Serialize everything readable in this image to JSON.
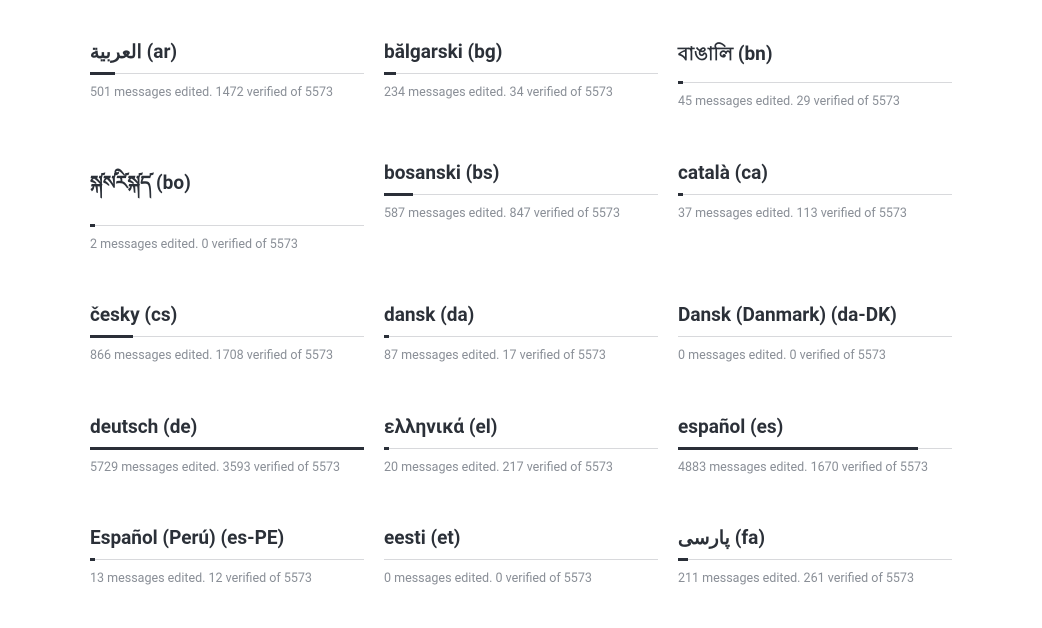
{
  "total_messages": 5573,
  "languages": [
    {
      "native": "العربية",
      "code": "ar",
      "edited": 501,
      "verified": 1472
    },
    {
      "native": "bălgarski",
      "code": "bg",
      "edited": 234,
      "verified": 34
    },
    {
      "native": "বাঙালি",
      "code": "bn",
      "edited": 45,
      "verified": 29
    },
    {
      "native": "སྐ༹ས༹རི༹སྐ༹ད༹",
      "code": "bo",
      "edited": 2,
      "verified": 0
    },
    {
      "native": "bosanski",
      "code": "bs",
      "edited": 587,
      "verified": 847
    },
    {
      "native": "català",
      "code": "ca",
      "edited": 37,
      "verified": 113
    },
    {
      "native": "česky",
      "code": "cs",
      "edited": 866,
      "verified": 1708
    },
    {
      "native": "dansk",
      "code": "da",
      "edited": 87,
      "verified": 17
    },
    {
      "native": "Dansk (Danmark)",
      "code": "da-DK",
      "edited": 0,
      "verified": 0
    },
    {
      "native": "deutsch",
      "code": "de",
      "edited": 5729,
      "verified": 3593
    },
    {
      "native": "ελληνικά",
      "code": "el",
      "edited": 20,
      "verified": 217
    },
    {
      "native": "español",
      "code": "es",
      "edited": 4883,
      "verified": 1670
    },
    {
      "native": "Español (Perú)",
      "code": "es-PE",
      "edited": 13,
      "verified": 12
    },
    {
      "native": "eesti",
      "code": "et",
      "edited": 0,
      "verified": 0
    },
    {
      "native": "پارسی",
      "code": "fa",
      "edited": 211,
      "verified": 261
    }
  ],
  "labels": {
    "messages_edited": "messages edited.",
    "verified_of": "verified of"
  }
}
